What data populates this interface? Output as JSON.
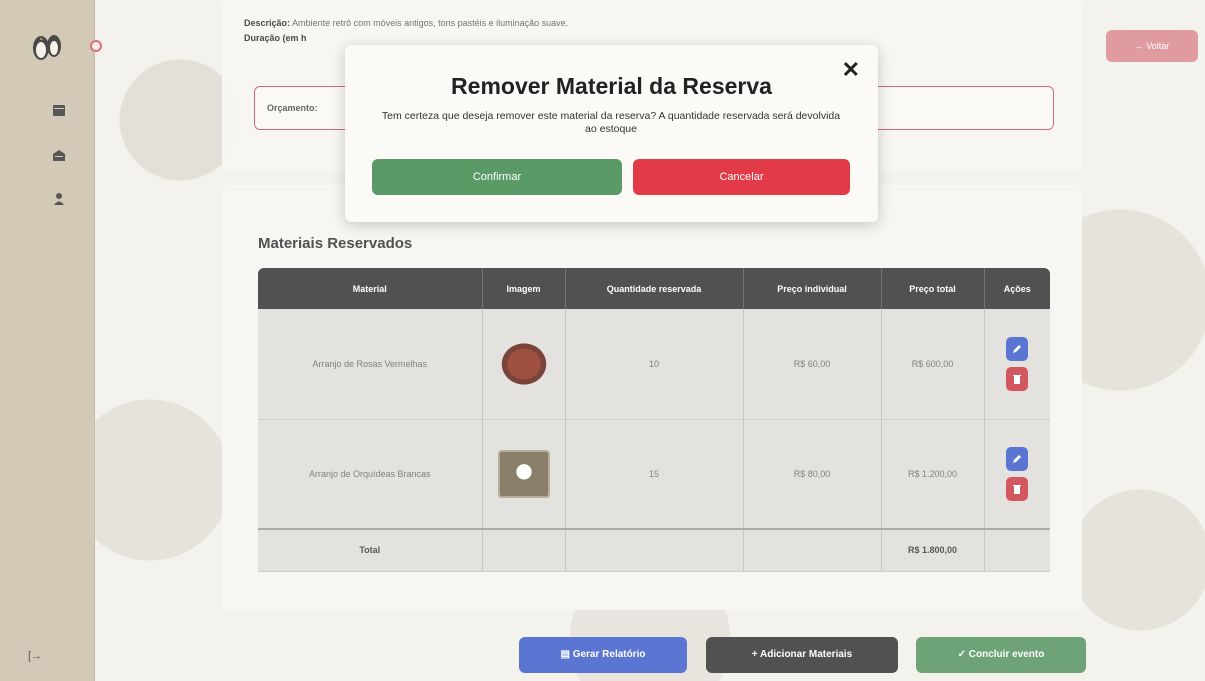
{
  "event": {
    "description_label": "Descrição:",
    "description_value": "Ambiente retrô com móveis antigos, tons pastéis e iluminação suave.",
    "duration_label": "Duração (em h",
    "budget_label": "Orçamento:"
  },
  "nav": {
    "back_label": "← Voltar"
  },
  "materials": {
    "title": "Materiais Reservados",
    "headers": [
      "Material",
      "Imagem",
      "Quantidade reservada",
      "Preço individual",
      "Preço total",
      "Ações"
    ],
    "rows": [
      {
        "material": "Arranjo de Rosas Vermelhas",
        "quantity": "10",
        "unit_price": "R$ 60,00",
        "total_price": "R$ 600,00"
      },
      {
        "material": "Arranjo de Orquídeas Brancas",
        "quantity": "15",
        "unit_price": "R$ 80,00",
        "total_price": "R$ 1.200,00"
      }
    ],
    "total_label": "Total",
    "total_value": "R$ 1.800,00"
  },
  "actions": {
    "report_label": "Gerar Relatório",
    "add_label": "+ Adicionar Materiais",
    "finish_label": "✓ Concluir evento"
  },
  "modal": {
    "title": "Remover Material da Reserva",
    "close_symbol": "✕",
    "message": "Tem certeza que deseja remover este material da reserva? A quantidade reservada será devolvida ao estoque",
    "confirm_label": "Confirmar",
    "cancel_label": "Cancelar"
  },
  "colors": {
    "primary_blue": "#3658c8",
    "danger_red": "#e23b47",
    "success_green": "#5a9a66",
    "sidebar_beige": "#c8bda6"
  },
  "icons": {
    "logo": "penguins-logo-icon",
    "nav1": "calendar-icon",
    "nav2": "box-icon",
    "nav3": "user-icon",
    "logout": "logout-icon",
    "edit": "pencil-icon",
    "delete": "trash-icon"
  }
}
